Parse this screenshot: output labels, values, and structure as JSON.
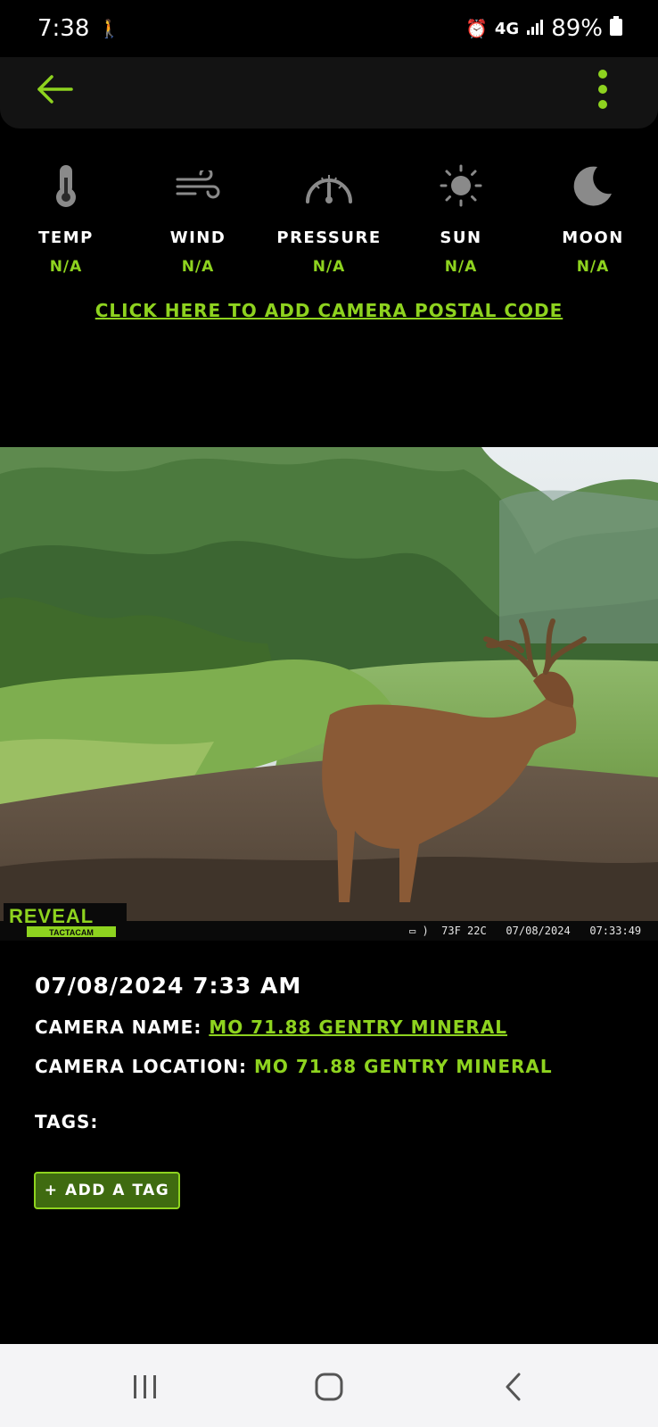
{
  "status_bar": {
    "time": "7:38",
    "network": "4G",
    "battery": "89%"
  },
  "app_bar": {
    "back_icon": "arrow-left-icon",
    "menu_icon": "more-vertical-icon"
  },
  "weather": [
    {
      "label": "TEMP",
      "value": "N/A",
      "icon": "thermometer-icon"
    },
    {
      "label": "WIND",
      "value": "N/A",
      "icon": "wind-icon"
    },
    {
      "label": "PRESSURE",
      "value": "N/A",
      "icon": "gauge-icon"
    },
    {
      "label": "SUN",
      "value": "N/A",
      "icon": "sun-icon"
    },
    {
      "label": "MOON",
      "value": "N/A",
      "icon": "moon-icon"
    }
  ],
  "postal_link": "CLICK HERE TO ADD CAMERA POSTAL CODE",
  "photo": {
    "brand": "REVEAL",
    "brand_sub": "TACTACAM",
    "overlay_temp": "73F 22C",
    "overlay_date": "07/08/2024",
    "overlay_time": "07:33:49"
  },
  "details": {
    "datetime": "07/08/2024 7:33 AM",
    "camera_name_label": "CAMERA NAME: ",
    "camera_name": "MO 71.88 GENTRY MINERAL",
    "camera_location_label": "CAMERA LOCATION: ",
    "camera_location": "MO 71.88 GENTRY MINERAL",
    "tags_label": "TAGS:"
  },
  "add_tag_button": "+ ADD A TAG",
  "colors": {
    "accent": "#8ed31f",
    "button_bg": "#3f6b10",
    "background": "#000000"
  }
}
